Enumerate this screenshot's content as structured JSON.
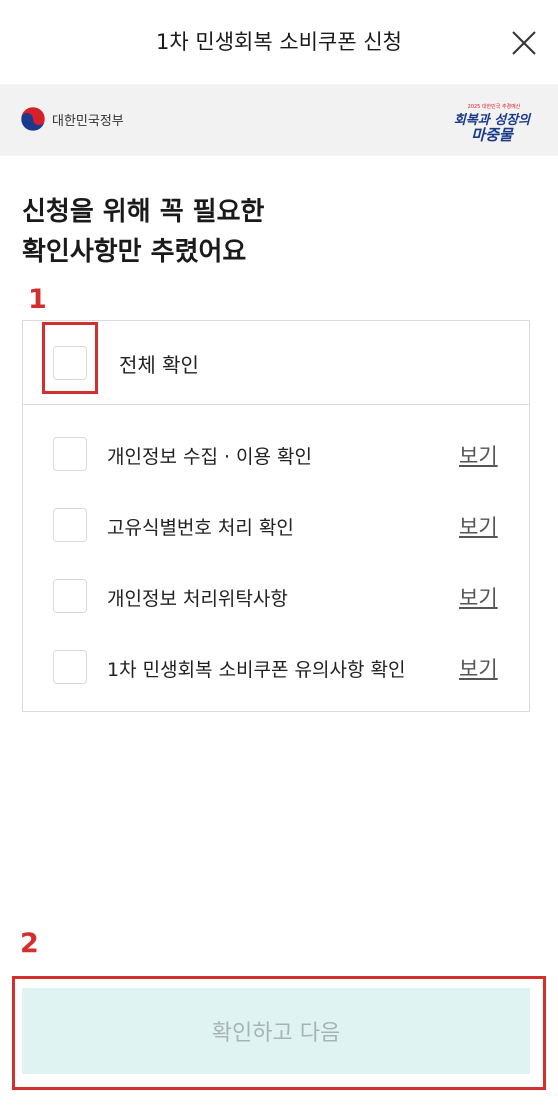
{
  "header": {
    "title": "1차 민생회복 소비쿠폰 신청",
    "close_icon": "close-icon"
  },
  "banner": {
    "gov_name": "대한민국정부",
    "campaign_small": "2025 대한민국 추경예산",
    "campaign_line1": "회복과 성장의",
    "campaign_line2": "마중물"
  },
  "heading": {
    "line1": "신청을 위해 꼭 필요한",
    "line2": "확인사항만 추렸어요"
  },
  "annotations": {
    "marker1": "1",
    "marker2": "2"
  },
  "agreements": {
    "all_label": "전체 확인",
    "items": [
      {
        "label": "개인정보 수집 · 이용 확인",
        "link": "보기"
      },
      {
        "label": "고유식별번호 처리 확인",
        "link": "보기"
      },
      {
        "label": "개인정보 처리위탁사항",
        "link": "보기"
      },
      {
        "label": "1차 민생회복 소비쿠폰 유의사항 확인",
        "link": "보기"
      }
    ]
  },
  "footer": {
    "next_label": "확인하고 다음"
  },
  "colors": {
    "annotation_red": "#d32f2f",
    "button_bg_disabled": "#dff3f3",
    "button_text_disabled": "#a8b4b4"
  }
}
